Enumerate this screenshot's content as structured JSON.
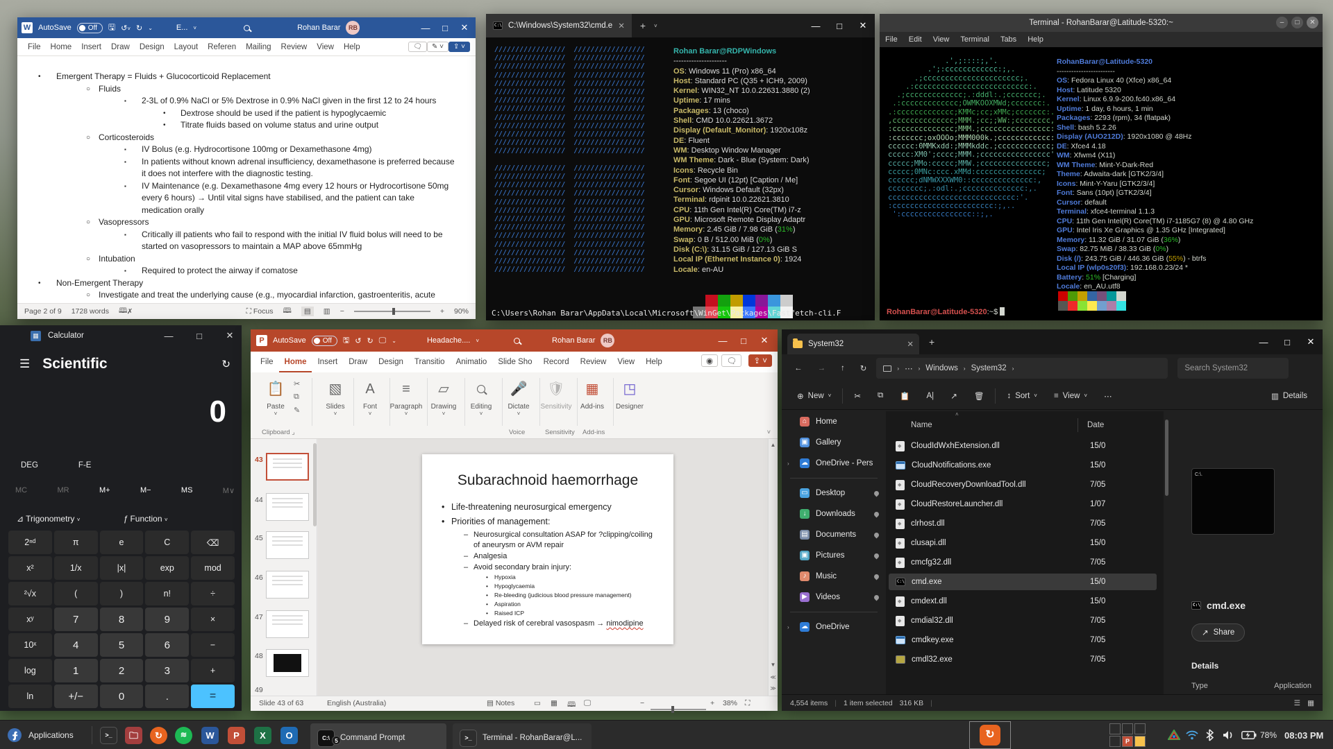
{
  "word": {
    "title": {
      "autosave": "AutoSave",
      "autosave_state": "Off",
      "doc_name": "E...",
      "user": "Rohan Barar",
      "initials": "RB"
    },
    "menu": [
      "File",
      "Home",
      "Insert",
      "Draw",
      "Design",
      "Layout",
      "Referen",
      "Mailing",
      "Review",
      "View",
      "Help"
    ],
    "doc_lines": [
      {
        "m": "•",
        "t": "Emergent Therapy = Fluids + Glucocorticoid Replacement"
      },
      {
        "m": "○",
        "t": "Fluids"
      },
      {
        "m": "▪",
        "t": "2-3L of 0.9% NaCl or 5% Dextrose in 0.9% NaCl given in the first 12 to 24 hours"
      },
      {
        "m": "•",
        "t": "Dextrose should be used if the patient is hypoglycaemic"
      },
      {
        "m": "•",
        "t": "Titrate fluids based on volume status and urine output"
      },
      {
        "m": "○",
        "t": "Corticosteroids"
      },
      {
        "m": "▪",
        "t": "IV Bolus (e.g. Hydrocortisone 100mg or Dexamethasone 4mg)"
      },
      {
        "m": "▪",
        "t": "In patients without known adrenal insufficiency, dexamethasone is preferred because"
      },
      {
        "m": "",
        "t": "it does not interfere with the diagnostic testing."
      },
      {
        "m": "▪",
        "t": "IV Maintenance (e.g. Dexamethasone 4mg every 12 hours or Hydrocortisone 50mg"
      },
      {
        "m": "",
        "t": "every 6 hours) → Until vital signs have stabilised, and the patient can take"
      },
      {
        "m": "",
        "t": "medication orally"
      },
      {
        "m": "○",
        "t": "Vasopressors"
      },
      {
        "m": "▪",
        "t": "Critically ill patients who fail to respond with the initial IV fluid bolus will need to be"
      },
      {
        "m": "",
        "t": "started on vasopressors to maintain a MAP above 65mmHg"
      },
      {
        "m": "○",
        "t": "Intubation"
      },
      {
        "m": "▪",
        "t": "Required to protect the airway if comatose"
      },
      {
        "m": "•",
        "t": "Non-Emergent Therapy"
      },
      {
        "m": "○",
        "t": "Investigate and treat the underlying cause (e.g., myocardial infarction, gastroenteritis, acute"
      }
    ],
    "status": {
      "page": "Page 2 of 9",
      "words": "1728 words",
      "focus": "Focus",
      "zoom": "90%"
    }
  },
  "cmd": {
    "tab": "C:\\Windows\\System32\\cmd.e",
    "ascii": "/////////////////  /////////////////\n/////////////////  /////////////////\n/////////////////  /////////////////\n/////////////////  /////////////////\n/////////////////  /////////////////\n/////////////////  /////////////////\n/////////////////  /////////////////\n/////////////////  /////////////////\n/////////////////  /////////////////\n/////////////////  /////////////////\n/////////////////  /////////////////\n/////////////////  /////////////////\n/////////////////  /////////////////\n\n/////////////////  /////////////////\n/////////////////  /////////////////\n/////////////////  /////////////////\n/////////////////  /////////////////\n/////////////////  /////////////////\n/////////////////  /////////////////\n/////////////////  /////////////////\n/////////////////  /////////////////\n/////////////////  /////////////////\n/////////////////  /////////////////\n/////////////////  /////////////////\n/////////////////  /////////////////\n/////////////////  /////////////////",
    "header": "Rohan Barar@RDPWindows",
    "sep": "---------------------",
    "ff": [
      {
        "k": "OS",
        "v": ": Windows 11 (Pro) x86_64"
      },
      {
        "k": "Host",
        "v": ": Standard PC (Q35 + ICH9, 2009)"
      },
      {
        "k": "Kernel",
        "v": ": WIN32_NT 10.0.22631.3880 (2)"
      },
      {
        "k": "Uptime",
        "v": ": 17 mins"
      },
      {
        "k": "Packages",
        "v": ": 13 (choco)"
      },
      {
        "k": "Shell",
        "v": ": CMD 10.0.22621.3672"
      },
      {
        "k": "Display (Default_Monitor)",
        "v": ": 1920x108z"
      },
      {
        "k": "DE",
        "v": ": Fluent"
      },
      {
        "k": "WM",
        "v": ": Desktop Window Manager"
      },
      {
        "k": "WM Theme",
        "v": ": Dark - Blue (System: Dark)"
      },
      {
        "k": "Icons",
        "v": ": Recycle Bin"
      },
      {
        "k": "Font",
        "v": ": Segoe UI (12pt) [Caption / Me]"
      },
      {
        "k": "Cursor",
        "v": ": Windows Default (32px)"
      },
      {
        "k": "Terminal",
        "v": ": rdpinit 10.0.22621.3810"
      },
      {
        "k": "CPU",
        "v": ": 11th Gen Intel(R) Core(TM) i7-z"
      },
      {
        "k": "GPU",
        "v": ": Microsoft Remote Display Adaptr"
      },
      {
        "k": "Memory",
        "v": ": 2.45 GiB / 7.98 GiB (",
        "p": "31%",
        "t": ")"
      },
      {
        "k": "Swap",
        "v": ": 0 B / 512.00 MiB (",
        "p": "0%",
        "t": ")"
      },
      {
        "k": "Disk (C:\\)",
        "v": ": 31.15 GiB / 127.13 GiB S"
      },
      {
        "k": "Local IP (Ethernet Instance 0)",
        "v": ": 1924"
      },
      {
        "k": "Locale",
        "v": ": en-AU"
      }
    ],
    "palette": [
      "#0c0c0c",
      "#c50f1f",
      "#13a10e",
      "#c19c00",
      "#0037da",
      "#881798",
      "#3a96dd",
      "#cccccc",
      "#767676",
      "#e74856",
      "#16c60c",
      "#f9f1a5",
      "#3b78ff",
      "#b4009e",
      "#61d6d6",
      "#f2f2f2"
    ],
    "path_line": "C:\\Users\\Rohan Barar\\AppData\\Local\\Microsoft\\WinGet\\Packages\\Fastfetch-cli.F"
  },
  "terminal": {
    "title": "Terminal - RohanBarar@Latitude-5320:~",
    "menu": [
      "File",
      "Edit",
      "View",
      "Terminal",
      "Tabs",
      "Help"
    ],
    "ascii": "             .',;::::;,'.\n         .';:cccccccccccc:;,.\n      .;cccccccccccccccccccccc;.\n    .:cccccccccccccccccccccccccc:.\n  .;ccccccccccccc;.:dddl:.;ccccccc;.\n .:ccccccccccccc;OWMKOOXMWd;ccccccc:.\n.:ccccccccccccc;KMMc;cc;xMMc;ccccccc:.\n,cccccccccccccc;MMM.;cc;;WW:;cccccccc,\n:cccccccccccccc;MMM.;cccccccccccccccc:\n:ccccccc;oxOOOo;MMM000k.;cccccccccccc:\ncccccc:0MMKxdd:;MMMkddc.;cccccccccccc;\nccccc:XM0';cccc;MMM.;cccccccccccccccc'\nccccc;MMo:ccccc;MMW.;ccccccccccccccc;\nccccc;0MNc:ccc.xMMd:ccccccccccccccc;\ncccccc;dNMWXXXWM0::cccccccccccccc:,\ncccccccc;.:odl:.;cccccccccccccc:,.\nccccccccccccccccccccccccccccc:'.\n:ccccccccccccccccccccccc:;,..\n ':cccccccccccccccc::;,.",
    "header": "RohanBarar@Latitude-5320",
    "sep": "------------------------",
    "ff": [
      {
        "k": "OS",
        "v": ": Fedora Linux 40 (Xfce) x86_64"
      },
      {
        "k": "Host",
        "v": ": Latitude 5320"
      },
      {
        "k": "Kernel",
        "v": ": Linux 6.9.9-200.fc40.x86_64"
      },
      {
        "k": "Uptime",
        "v": ": 1 day, 6 hours, 1 min"
      },
      {
        "k": "Packages",
        "v": ": 2293 (rpm), 34 (flatpak)"
      },
      {
        "k": "Shell",
        "v": ": bash 5.2.26"
      },
      {
        "k": "Display (AUO212D)",
        "v": ": 1920x1080 @ 48Hz"
      },
      {
        "k": "DE",
        "v": ": Xfce4 4.18"
      },
      {
        "k": "WM",
        "v": ": Xfwm4 (X11)"
      },
      {
        "k": "WM Theme",
        "v": ": Mint-Y-Dark-Red"
      },
      {
        "k": "Theme",
        "v": ": Adwaita-dark [GTK2/3/4]"
      },
      {
        "k": "Icons",
        "v": ": Mint-Y-Yaru [GTK2/3/4]"
      },
      {
        "k": "Font",
        "v": ": Sans (10pt) [GTK2/3/4]"
      },
      {
        "k": "Cursor",
        "v": ": default"
      },
      {
        "k": "Terminal",
        "v": ": xfce4-terminal 1.1.3"
      },
      {
        "k": "CPU",
        "v": ": 11th Gen Intel(R) Core(TM) i7-1185G7 (8) @ 4.80 GHz"
      },
      {
        "k": "GPU",
        "v": ": Intel Iris Xe Graphics @ 1.35 GHz [Integrated]"
      },
      {
        "k": "Memory",
        "v": ": 11.32 GiB / 31.07 GiB (",
        "p": "36%",
        "t": ")"
      },
      {
        "k": "Swap",
        "v": ": 82.75 MiB / 38.33 GiB (",
        "p": "0%",
        "t": ")"
      },
      {
        "k": "Disk (/)",
        "v": ": 243.75 GiB / 446.36 GiB (",
        "p": "55%",
        "t": ") - btrfs"
      },
      {
        "k": "Local IP (wlp0s20f3)",
        "v": ": 192.168.0.23/24 *"
      },
      {
        "k": "Battery",
        "v": ": ",
        "p": "51%",
        "t": " [Charging]"
      },
      {
        "k": "Locale",
        "v": ": en_AU.utf8"
      }
    ],
    "palette": [
      "#cc0000",
      "#4e9a06",
      "#c4a000",
      "#3465a4",
      "#75507b",
      "#06989a",
      "#d3d7cf",
      "#555753",
      "#ef2929",
      "#8ae234",
      "#fce94f",
      "#729fcf",
      "#ad7fa8",
      "#34e2e2",
      "#eeeeec"
    ],
    "prompt_user": "RohanBarar@Latitude-5320",
    "prompt_tail": ":~$"
  },
  "calculator": {
    "title": "Calculator",
    "mode": "Scientific",
    "display": "0",
    "deg": "DEG",
    "fe": "F-E",
    "memory": [
      "MC",
      "MR",
      "M+",
      "M−",
      "MS",
      "M∨"
    ],
    "trig": "Trigonometry",
    "func": "Function",
    "keys": [
      "2ⁿᵈ",
      "π",
      "e",
      "C",
      "⌫",
      "x²",
      "1/x",
      "|x|",
      "exp",
      "mod",
      "²√x",
      "(",
      ")",
      "n!",
      "÷",
      "xʸ",
      "7",
      "8",
      "9",
      "×",
      "10ˣ",
      "4",
      "5",
      "6",
      "−",
      "log",
      "1",
      "2",
      "3",
      "+",
      "ln",
      "+/−",
      "0",
      ".",
      "="
    ]
  },
  "powerpoint": {
    "title": {
      "autosave": "AutoSave",
      "autosave_state": "Off",
      "doc_name": "Headache....",
      "user": "Rohan Barar",
      "initials": "RB"
    },
    "tabs": [
      "File",
      "Home",
      "Insert",
      "Draw",
      "Design",
      "Transitio",
      "Animatio",
      "Slide Sho",
      "Record",
      "Review",
      "View",
      "Help"
    ],
    "ribbon": {
      "buttons": [
        "Paste",
        "Slides",
        "Font",
        "Paragraph",
        "Drawing",
        "Editing",
        "Dictate",
        "Sensitivity",
        "Add-ins",
        "Designer"
      ],
      "groups": [
        "Clipboard",
        "Voice",
        "Sensitivity",
        "Add-ins"
      ]
    },
    "thumbs": [
      "43",
      "44",
      "45",
      "46",
      "47",
      "48",
      "49"
    ],
    "slide": {
      "title": "Subarachnoid haemorrhage",
      "bullets": [
        {
          "m": "•",
          "t": "Life-threatening neurosurgical emergency"
        },
        {
          "m": "•",
          "t": "Priorities of management:"
        },
        {
          "m": "–",
          "t": "Neurosurgical consultation ASAP for ?clipping/coiling"
        },
        {
          "m": "",
          "t": "of aneurysm or AVM repair"
        },
        {
          "m": "–",
          "t": "Analgesia"
        },
        {
          "m": "–",
          "t": "Avoid secondary brain injury:"
        },
        {
          "m": "•",
          "t": "Hypoxia"
        },
        {
          "m": "•",
          "t": "Hypoglycaemia"
        },
        {
          "m": "•",
          "t": "Re-bleeding (judicious blood pressure management)"
        },
        {
          "m": "•",
          "t": "Aspiration"
        },
        {
          "m": "•",
          "t": "Raised ICP"
        },
        {
          "m": "–",
          "t": "Delayed risk of cerebral vasospasm → "
        }
      ],
      "squiggle": "nimodipine"
    },
    "status": {
      "slide": "Slide 43 of 63",
      "lang": "English (Australia)",
      "notes": "Notes",
      "zoom": "38%"
    }
  },
  "explorer": {
    "tab": "System32",
    "search": "Search System32",
    "crumbs": {
      "ellipsis": "⋯",
      "c1": "Windows",
      "c2": "System32"
    },
    "toolbar": {
      "new": "New",
      "sort": "Sort",
      "view": "View",
      "details": "Details"
    },
    "sidebar": [
      {
        "label": "Home"
      },
      {
        "label": "Gallery"
      },
      {
        "label": "OneDrive - Pers"
      },
      {
        "label": "Desktop"
      },
      {
        "label": "Downloads"
      },
      {
        "label": "Documents"
      },
      {
        "label": "Pictures"
      },
      {
        "label": "Music"
      },
      {
        "label": "Videos"
      },
      {
        "label": "OneDrive"
      }
    ],
    "columns": {
      "name": "Name",
      "date": "Date"
    },
    "files": [
      {
        "n": "CloudIdWxhExtension.dll",
        "d": "15/0"
      },
      {
        "n": "CloudNotifications.exe",
        "d": "15/0"
      },
      {
        "n": "CloudRecoveryDownloadTool.dll",
        "d": "7/05"
      },
      {
        "n": "CloudRestoreLauncher.dll",
        "d": "1/07"
      },
      {
        "n": "clrhost.dll",
        "d": "7/05"
      },
      {
        "n": "clusapi.dll",
        "d": "15/0"
      },
      {
        "n": "cmcfg32.dll",
        "d": "7/05"
      },
      {
        "n": "cmd.exe",
        "d": "15/0"
      },
      {
        "n": "cmdext.dll",
        "d": "15/0"
      },
      {
        "n": "cmdial32.dll",
        "d": "7/05"
      },
      {
        "n": "cmdkey.exe",
        "d": "7/05"
      },
      {
        "n": "cmdl32.exe",
        "d": "7/05"
      }
    ],
    "preview": {
      "thumb_text": "C:\\.",
      "name": "cmd.exe",
      "share": "Share",
      "details": "Details",
      "type_label": "Type",
      "type_value": "Application"
    },
    "status": {
      "items": "4,554 items",
      "selected": "1 item selected",
      "size": "316 KB"
    }
  },
  "taskbar": {
    "apps_label": "Applications",
    "tasks": [
      {
        "label": "Command Prompt",
        "badge": "5"
      },
      {
        "label": "Terminal - RohanBarar@L..."
      }
    ],
    "battery": "78%",
    "clock": "08:03 PM"
  },
  "colors": {
    "word_titlebar": "#2b579a",
    "ppt_titlebar": "#b7472a",
    "calc_equals": "#4cc2ff",
    "cmd_ascii": "#3c7dd9",
    "fastfetch_label_cmd": "#c8b968",
    "fastfetch_label_term": "#4f7bd9",
    "selection_row": "#3a3a3a"
  }
}
